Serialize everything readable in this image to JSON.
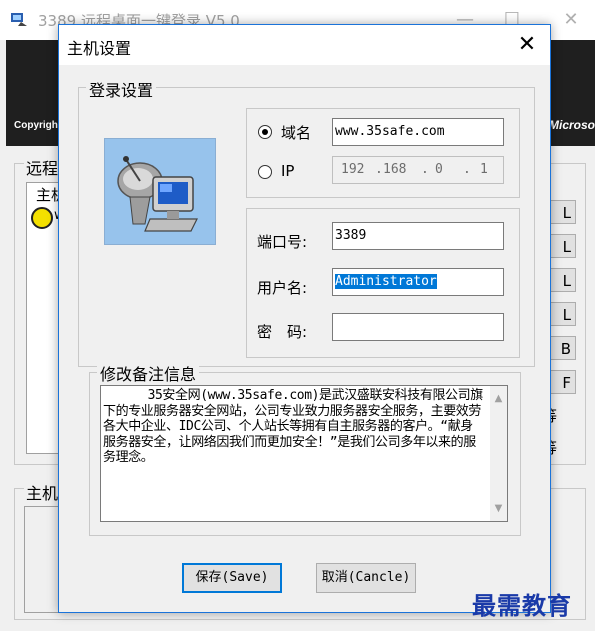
{
  "main_window": {
    "title": "3389 远程桌面一键登录 V5.0",
    "minimize": "—",
    "maximize": "☐",
    "close": "✕",
    "banner_left_text": "Copyrigh",
    "banner_right_text": "Microso",
    "remote_group_label": "远程",
    "list_header": "主机",
    "list_row_text": "w",
    "side_buttons": [
      "L",
      "L",
      "L",
      "L",
      "B",
      "F"
    ],
    "side_texts": [
      "等",
      "等"
    ],
    "host_group_label": "主机"
  },
  "dialog": {
    "title": "主机设置",
    "close": "✕",
    "login_group_label": "登录设置",
    "domain_radio_label": "域名",
    "domain_value": "www.35safe.com",
    "ip_radio_label": "IP",
    "ip_parts": [
      "192",
      "168",
      "0",
      "1"
    ],
    "ip_dots": [
      ".",
      ".",
      "."
    ],
    "port_label": "端口号:",
    "port_value": "3389",
    "username_label": "用户名:",
    "username_value": "Administrator",
    "password_label": "密　码:",
    "password_value": "",
    "memo_group_label": "修改备注信息",
    "memo_text": "      35安全网(www.35safe.com)是武汉盛联安科技有限公司旗下的专业服务器安全网站，公司专业致力服务器安全服务，主要效劳各大中企业、IDC公司、个人站长等拥有自主服务器的客户。“献身服务器安全，让网络因我们而更加安全！”是我们公司多年以来的服务理念。",
    "scroll_up": "▲",
    "scroll_down": "▼",
    "save_button": "保存(Save)",
    "cancel_button": "取消(Cancle)"
  },
  "watermark": "最需教育",
  "colors": {
    "accent": "#0078d7",
    "dialog_border": "#1a73d9",
    "banner": "#1f1f1f",
    "watermark": "#1a3aa8"
  }
}
